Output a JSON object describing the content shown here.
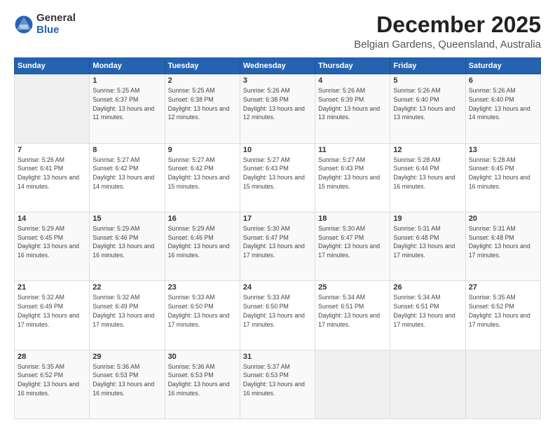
{
  "logo": {
    "general": "General",
    "blue": "Blue"
  },
  "header": {
    "title": "December 2025",
    "subtitle": "Belgian Gardens, Queensland, Australia"
  },
  "days_of_week": [
    "Sunday",
    "Monday",
    "Tuesday",
    "Wednesday",
    "Thursday",
    "Friday",
    "Saturday"
  ],
  "weeks": [
    [
      {
        "day": "",
        "empty": true
      },
      {
        "day": "1",
        "sunrise": "Sunrise: 5:25 AM",
        "sunset": "Sunset: 6:37 PM",
        "daylight": "Daylight: 13 hours and 11 minutes."
      },
      {
        "day": "2",
        "sunrise": "Sunrise: 5:25 AM",
        "sunset": "Sunset: 6:38 PM",
        "daylight": "Daylight: 13 hours and 12 minutes."
      },
      {
        "day": "3",
        "sunrise": "Sunrise: 5:26 AM",
        "sunset": "Sunset: 6:38 PM",
        "daylight": "Daylight: 13 hours and 12 minutes."
      },
      {
        "day": "4",
        "sunrise": "Sunrise: 5:26 AM",
        "sunset": "Sunset: 6:39 PM",
        "daylight": "Daylight: 13 hours and 13 minutes."
      },
      {
        "day": "5",
        "sunrise": "Sunrise: 5:26 AM",
        "sunset": "Sunset: 6:40 PM",
        "daylight": "Daylight: 13 hours and 13 minutes."
      },
      {
        "day": "6",
        "sunrise": "Sunrise: 5:26 AM",
        "sunset": "Sunset: 6:40 PM",
        "daylight": "Daylight: 13 hours and 14 minutes."
      }
    ],
    [
      {
        "day": "7",
        "sunrise": "Sunrise: 5:26 AM",
        "sunset": "Sunset: 6:41 PM",
        "daylight": "Daylight: 13 hours and 14 minutes."
      },
      {
        "day": "8",
        "sunrise": "Sunrise: 5:27 AM",
        "sunset": "Sunset: 6:42 PM",
        "daylight": "Daylight: 13 hours and 14 minutes."
      },
      {
        "day": "9",
        "sunrise": "Sunrise: 5:27 AM",
        "sunset": "Sunset: 6:42 PM",
        "daylight": "Daylight: 13 hours and 15 minutes."
      },
      {
        "day": "10",
        "sunrise": "Sunrise: 5:27 AM",
        "sunset": "Sunset: 6:43 PM",
        "daylight": "Daylight: 13 hours and 15 minutes."
      },
      {
        "day": "11",
        "sunrise": "Sunrise: 5:27 AM",
        "sunset": "Sunset: 6:43 PM",
        "daylight": "Daylight: 13 hours and 15 minutes."
      },
      {
        "day": "12",
        "sunrise": "Sunrise: 5:28 AM",
        "sunset": "Sunset: 6:44 PM",
        "daylight": "Daylight: 13 hours and 16 minutes."
      },
      {
        "day": "13",
        "sunrise": "Sunrise: 5:28 AM",
        "sunset": "Sunset: 6:45 PM",
        "daylight": "Daylight: 13 hours and 16 minutes."
      }
    ],
    [
      {
        "day": "14",
        "sunrise": "Sunrise: 5:29 AM",
        "sunset": "Sunset: 6:45 PM",
        "daylight": "Daylight: 13 hours and 16 minutes."
      },
      {
        "day": "15",
        "sunrise": "Sunrise: 5:29 AM",
        "sunset": "Sunset: 6:46 PM",
        "daylight": "Daylight: 13 hours and 16 minutes."
      },
      {
        "day": "16",
        "sunrise": "Sunrise: 5:29 AM",
        "sunset": "Sunset: 6:46 PM",
        "daylight": "Daylight: 13 hours and 16 minutes."
      },
      {
        "day": "17",
        "sunrise": "Sunrise: 5:30 AM",
        "sunset": "Sunset: 6:47 PM",
        "daylight": "Daylight: 13 hours and 17 minutes."
      },
      {
        "day": "18",
        "sunrise": "Sunrise: 5:30 AM",
        "sunset": "Sunset: 6:47 PM",
        "daylight": "Daylight: 13 hours and 17 minutes."
      },
      {
        "day": "19",
        "sunrise": "Sunrise: 5:31 AM",
        "sunset": "Sunset: 6:48 PM",
        "daylight": "Daylight: 13 hours and 17 minutes."
      },
      {
        "day": "20",
        "sunrise": "Sunrise: 5:31 AM",
        "sunset": "Sunset: 6:48 PM",
        "daylight": "Daylight: 13 hours and 17 minutes."
      }
    ],
    [
      {
        "day": "21",
        "sunrise": "Sunrise: 5:32 AM",
        "sunset": "Sunset: 6:49 PM",
        "daylight": "Daylight: 13 hours and 17 minutes."
      },
      {
        "day": "22",
        "sunrise": "Sunrise: 5:32 AM",
        "sunset": "Sunset: 6:49 PM",
        "daylight": "Daylight: 13 hours and 17 minutes."
      },
      {
        "day": "23",
        "sunrise": "Sunrise: 5:33 AM",
        "sunset": "Sunset: 6:50 PM",
        "daylight": "Daylight: 13 hours and 17 minutes."
      },
      {
        "day": "24",
        "sunrise": "Sunrise: 5:33 AM",
        "sunset": "Sunset: 6:50 PM",
        "daylight": "Daylight: 13 hours and 17 minutes."
      },
      {
        "day": "25",
        "sunrise": "Sunrise: 5:34 AM",
        "sunset": "Sunset: 6:51 PM",
        "daylight": "Daylight: 13 hours and 17 minutes."
      },
      {
        "day": "26",
        "sunrise": "Sunrise: 5:34 AM",
        "sunset": "Sunset: 6:51 PM",
        "daylight": "Daylight: 13 hours and 17 minutes."
      },
      {
        "day": "27",
        "sunrise": "Sunrise: 5:35 AM",
        "sunset": "Sunset: 6:52 PM",
        "daylight": "Daylight: 13 hours and 17 minutes."
      }
    ],
    [
      {
        "day": "28",
        "sunrise": "Sunrise: 5:35 AM",
        "sunset": "Sunset: 6:52 PM",
        "daylight": "Daylight: 13 hours and 16 minutes."
      },
      {
        "day": "29",
        "sunrise": "Sunrise: 5:36 AM",
        "sunset": "Sunset: 6:53 PM",
        "daylight": "Daylight: 13 hours and 16 minutes."
      },
      {
        "day": "30",
        "sunrise": "Sunrise: 5:36 AM",
        "sunset": "Sunset: 6:53 PM",
        "daylight": "Daylight: 13 hours and 16 minutes."
      },
      {
        "day": "31",
        "sunrise": "Sunrise: 5:37 AM",
        "sunset": "Sunset: 6:53 PM",
        "daylight": "Daylight: 13 hours and 16 minutes."
      },
      {
        "day": "",
        "empty": true
      },
      {
        "day": "",
        "empty": true
      },
      {
        "day": "",
        "empty": true
      }
    ]
  ]
}
